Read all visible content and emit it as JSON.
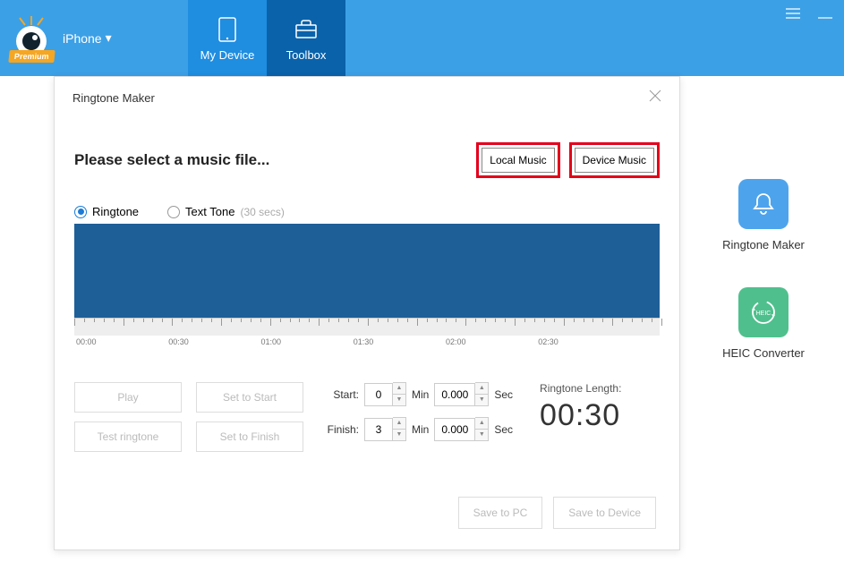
{
  "header": {
    "device_label": "iPhone",
    "premium": "Premium",
    "tabs": {
      "my_device": "My Device",
      "toolbox": "Toolbox"
    }
  },
  "side_tools": {
    "ringtone_maker": "Ringtone Maker",
    "heic_converter": "HEIC Converter",
    "heic_badge": "HEIC"
  },
  "dialog": {
    "title": "Ringtone Maker",
    "select_msg": "Please select a music file...",
    "local_music": "Local Music",
    "device_music": "Device Music",
    "radio": {
      "ringtone": "Ringtone",
      "text_tone": "Text Tone",
      "text_tone_sub": "(30 secs)"
    },
    "timeline": [
      "00:00",
      "00:30",
      "01:00",
      "01:30",
      "02:00",
      "02:30"
    ],
    "buttons": {
      "play": "Play",
      "test": "Test ringtone",
      "set_start": "Set to Start",
      "set_finish": "Set to Finish"
    },
    "time": {
      "start_label": "Start:",
      "finish_label": "Finish:",
      "min_unit": "Min",
      "sec_unit": "Sec",
      "start_min": "0",
      "start_sec": "0.000",
      "finish_min": "3",
      "finish_sec": "0.000"
    },
    "length": {
      "title": "Ringtone Length:",
      "value": "00:30"
    },
    "footer": {
      "save_pc": "Save to PC",
      "save_device": "Save to Device"
    }
  }
}
